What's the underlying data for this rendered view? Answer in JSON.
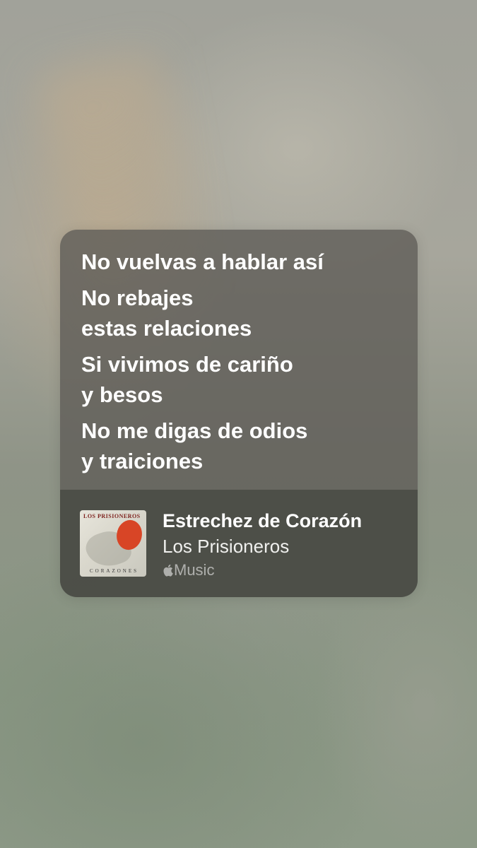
{
  "lyrics": [
    "No vuelvas a hablar así",
    "No rebajes\nestas relaciones",
    "Si vivimos de cariño\ny besos",
    "No me digas de odios\ny traiciones"
  ],
  "track": {
    "title": "Estrechez de Corazón",
    "artist": "Los Prisioneros",
    "service": "Music",
    "service_icon": "apple-logo-icon"
  },
  "album_art": {
    "top_text": "LOS PRISIONEROS",
    "bottom_text": "CORAZONES"
  },
  "colors": {
    "accent_red": "#d84526",
    "text": "#ffffff"
  }
}
